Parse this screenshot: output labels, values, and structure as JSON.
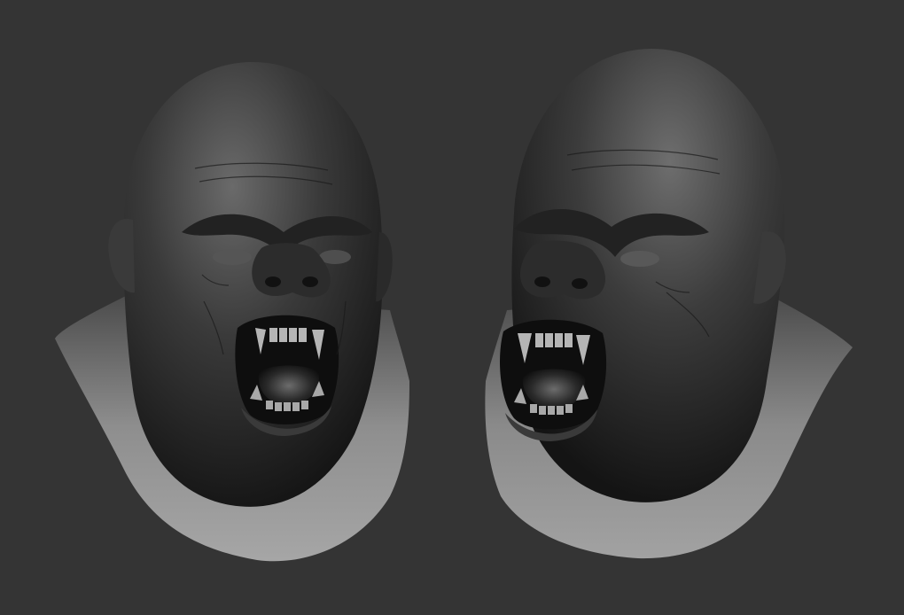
{
  "scene": {
    "background_color": "#343434",
    "subjects": [
      {
        "id": "left",
        "description_icon": "sculpt-head-icon",
        "view": "three-quarter-left"
      },
      {
        "id": "right",
        "description_icon": "sculpt-head-icon",
        "view": "three-quarter-right"
      }
    ],
    "palette": {
      "skin_dark": "#1c1c1c",
      "skin_mid": "#5a5a5a",
      "skin_light": "#a8a8a8",
      "neck_light": "#9a9a9a",
      "mouth_dark": "#0d0d0d",
      "teeth": "#b8b8b8",
      "tongue": "#7a7a7a"
    }
  }
}
